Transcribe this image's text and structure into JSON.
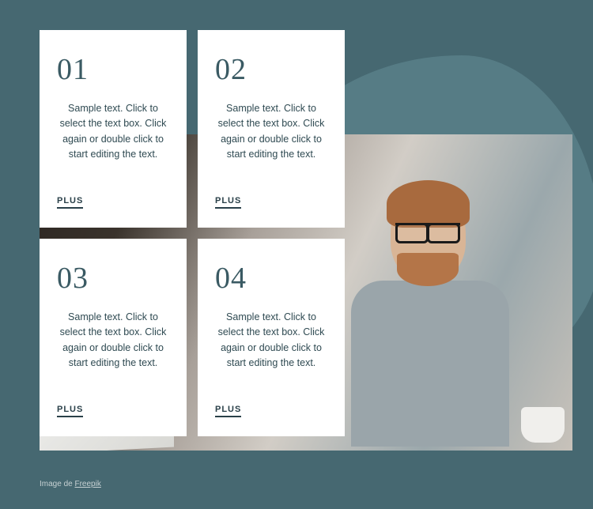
{
  "cards": [
    {
      "number": "01",
      "text": "Sample text. Click to select the text box. Click again or double click to start editing the text.",
      "cta": "PLUS"
    },
    {
      "number": "02",
      "text": "Sample text. Click to select the text box. Click again or double click to start editing the text.",
      "cta": "PLUS"
    },
    {
      "number": "03",
      "text": "Sample text. Click to select the text box. Click again or double click to start editing the text.",
      "cta": "PLUS"
    },
    {
      "number": "04",
      "text": "Sample text. Click to select the text box. Click again or double click to start editing the text.",
      "cta": "PLUS"
    }
  ],
  "credit": {
    "prefix": "Image de ",
    "source": "Freepik"
  },
  "colors": {
    "background": "#466871",
    "blob": "#567c85",
    "card_bg": "#ffffff",
    "text": "#2f4a52"
  }
}
